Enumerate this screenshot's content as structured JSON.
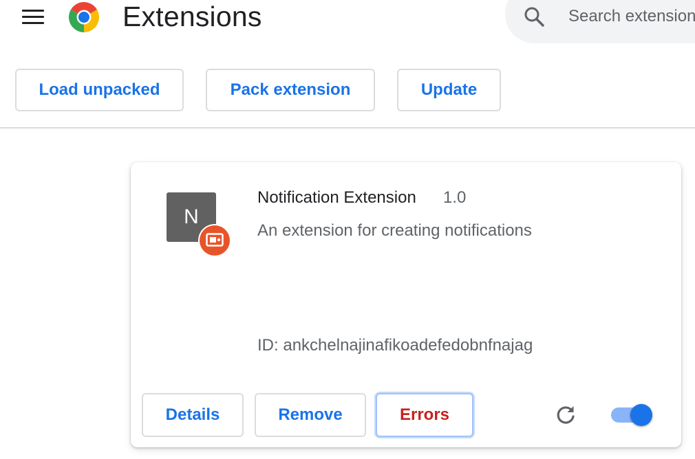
{
  "header": {
    "title": "Extensions",
    "search_placeholder": "Search extensions",
    "icons": {
      "menu": "menu-icon",
      "logo": "chrome-logo-icon",
      "search": "search-icon"
    }
  },
  "toolbar": {
    "load_unpacked_label": "Load unpacked",
    "pack_extension_label": "Pack extension",
    "update_label": "Update"
  },
  "extension": {
    "name": "Notification Extension",
    "version": "1.0",
    "description": "An extension for creating notifications",
    "icon_letter": "N",
    "id_label": "ID: ",
    "id_value": "ankchelnajinafikoadefedobnfnajag",
    "details_label": "Details",
    "remove_label": "Remove",
    "errors_label": "Errors",
    "enabled": true
  },
  "colors": {
    "accent": "#1a73e8",
    "error": "#c5221f",
    "badge": "#e8542a",
    "icon_bg": "#616161",
    "toggle_track": "#8ab4f8"
  }
}
